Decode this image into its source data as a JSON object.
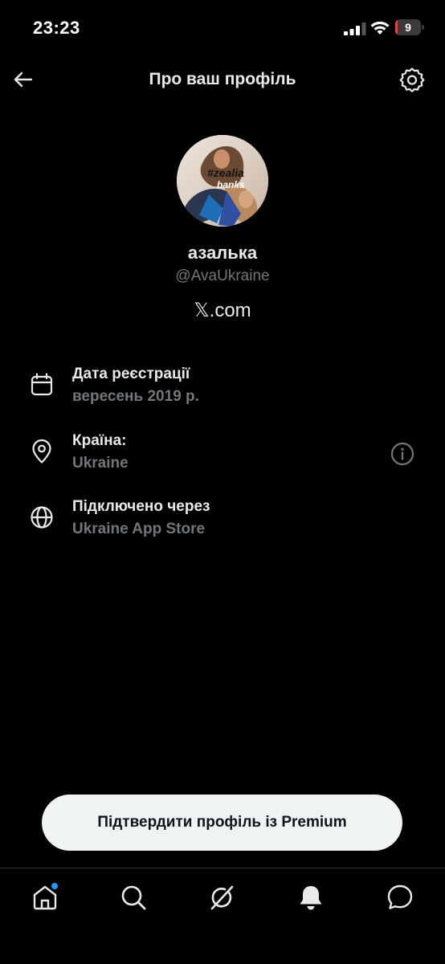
{
  "status_bar": {
    "time": "23:23",
    "battery_level": "9",
    "battery_color": "#ff3b30"
  },
  "header": {
    "title": "Про ваш профіль",
    "back_icon": "arrow-left-icon",
    "settings_icon": "gear-icon"
  },
  "profile": {
    "display_name": "азалька",
    "handle": "@AvaUkraine",
    "site": "𝕏.com"
  },
  "info": [
    {
      "icon": "calendar-icon",
      "label": "Дата реєстрації",
      "value": "вересень 2019 р."
    },
    {
      "icon": "location-pin-icon",
      "label": "Країна:",
      "value": "Ukraine",
      "action_icon": "info-icon"
    },
    {
      "icon": "globe-icon",
      "label": "Підключено через",
      "value": "Ukraine App Store"
    }
  ],
  "premium_button": {
    "label": "Підтвердити профіль із Premium"
  },
  "bottom_nav": [
    {
      "icon": "home-icon",
      "has_notification_dot": true
    },
    {
      "icon": "search-icon"
    },
    {
      "icon": "grok-icon"
    },
    {
      "icon": "bell-icon"
    },
    {
      "icon": "chat-bubble-icon"
    }
  ],
  "colors": {
    "background": "#000000",
    "primary_text": "#e7e9ea",
    "secondary_text": "#71767b",
    "accent": "#1d9bf0",
    "button_bg": "#eff3f4"
  }
}
